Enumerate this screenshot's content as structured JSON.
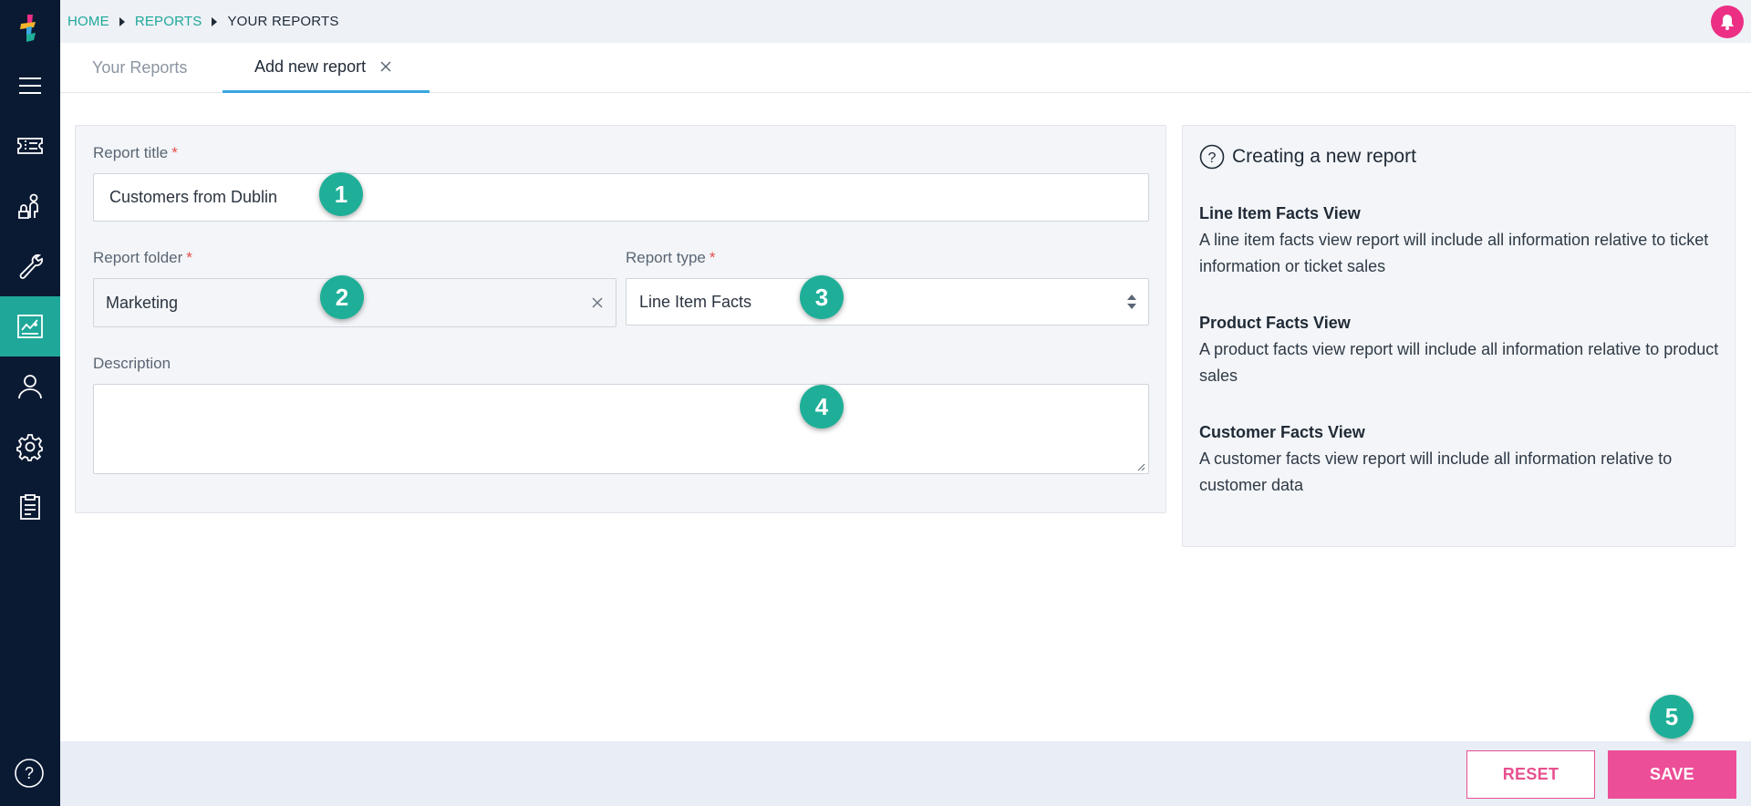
{
  "breadcrumb": {
    "home": "HOME",
    "reports": "REPORTS",
    "current": "YOUR REPORTS"
  },
  "tabs": [
    {
      "label": "Your Reports"
    },
    {
      "label": "Add new report"
    }
  ],
  "form": {
    "title_label": "Report title",
    "title_value": "Customers from Dublin",
    "folder_label": "Report folder",
    "folder_value": "Marketing",
    "type_label": "Report type",
    "type_value": "Line Item Facts",
    "description_label": "Description",
    "description_value": "",
    "required_mark": "*"
  },
  "help": {
    "heading": "Creating a new report",
    "sections": [
      {
        "title": "Line Item Facts View",
        "text": "A line item facts view report will include all information relative to ticket information or ticket sales"
      },
      {
        "title": "Product Facts View",
        "text": "A product facts view report will include all information relative to product sales"
      },
      {
        "title": "Customer Facts View",
        "text": "A customer facts view report will include all information relative to customer data"
      }
    ]
  },
  "buttons": {
    "reset": "RESET",
    "save": "SAVE"
  },
  "markers": [
    "1",
    "2",
    "3",
    "4",
    "5"
  ],
  "sidebar": {
    "items": [
      {
        "icon": "menu-icon"
      },
      {
        "icon": "ticket-icon"
      },
      {
        "icon": "attendee-icon"
      },
      {
        "icon": "wrench-icon"
      },
      {
        "icon": "reports-icon",
        "active": true
      },
      {
        "icon": "user-icon"
      },
      {
        "icon": "gear-icon"
      },
      {
        "icon": "clipboard-icon"
      }
    ],
    "help_icon": "help-icon"
  },
  "colors": {
    "sidebar_bg": "#0b1a33",
    "accent_teal": "#1fa89a",
    "brand_pink": "#ec2f85",
    "tab_underline": "#3aa7e0"
  }
}
